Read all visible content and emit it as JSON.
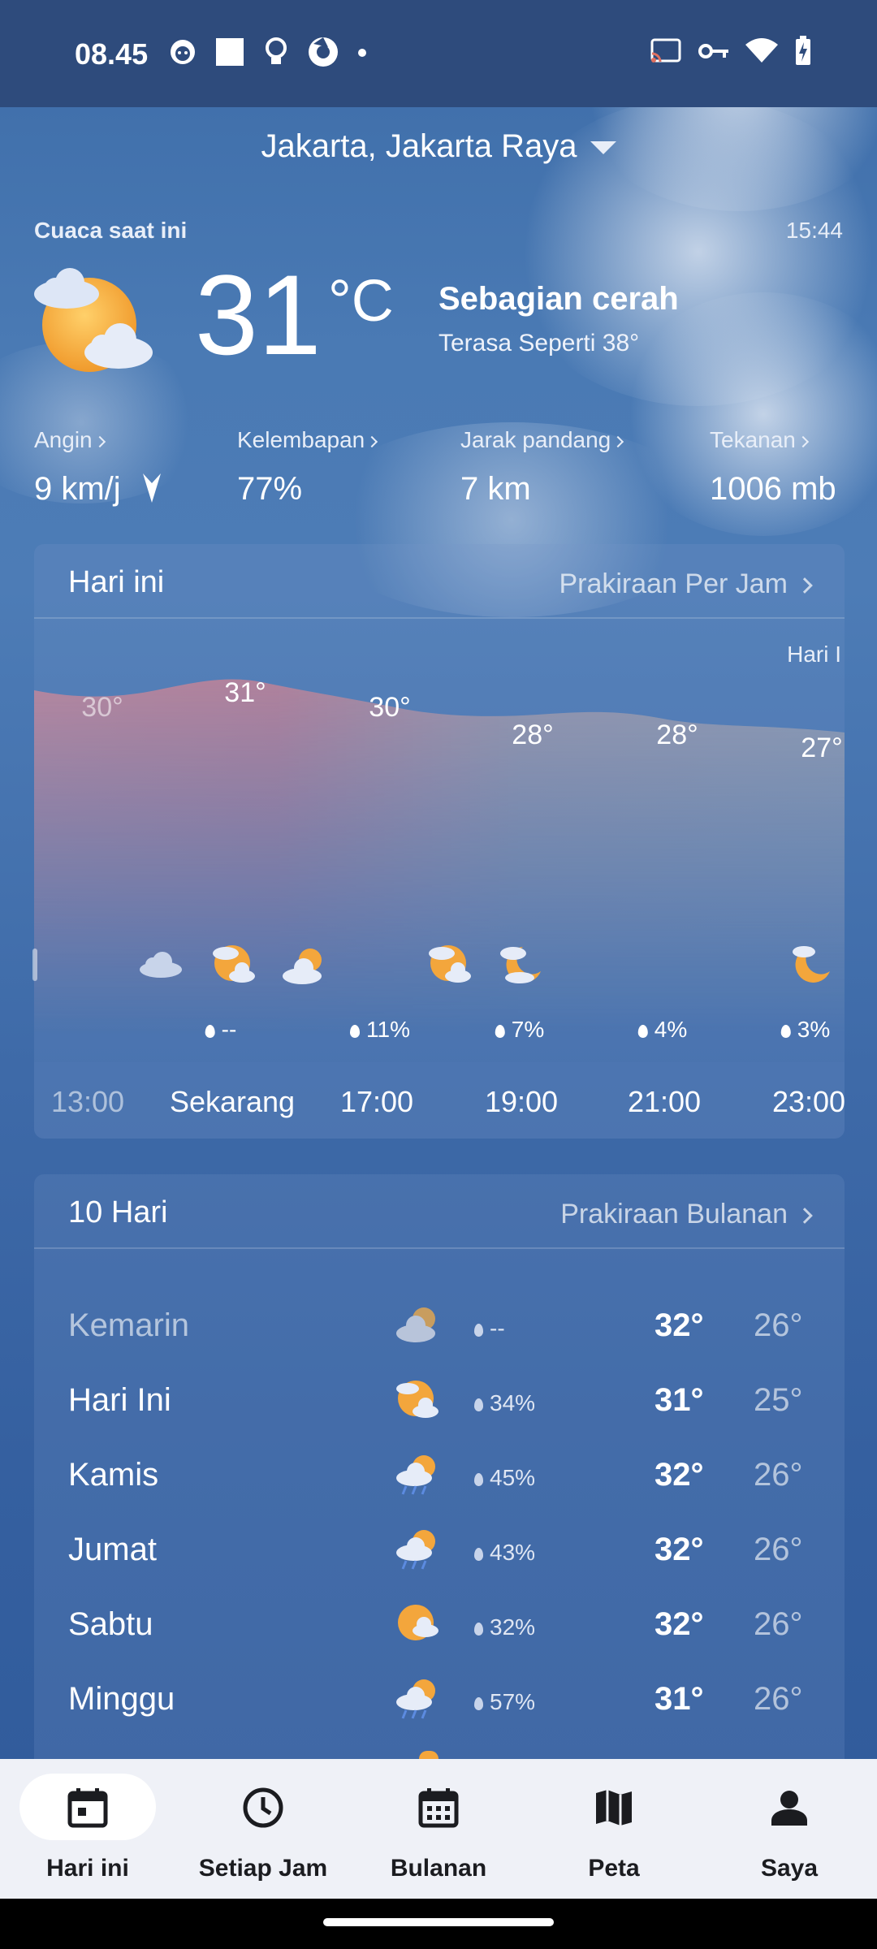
{
  "status_bar": {
    "time": "08.45"
  },
  "location": "Jakarta, Jakarta Raya",
  "current": {
    "label": "Cuaca saat ini",
    "updated": "15:44",
    "temperature": "31",
    "unit": "°C",
    "condition": "Sebagian cerah",
    "feels_like": "Terasa Seperti 38°",
    "icon": "partly-cloudy-icon"
  },
  "metrics": [
    {
      "label": "Angin",
      "value": "9 km/j"
    },
    {
      "label": "Kelembapan",
      "value": "77%"
    },
    {
      "label": "Jarak pandang",
      "value": "7 km"
    },
    {
      "label": "Tekanan",
      "value": "1006 mb"
    }
  ],
  "hourly": {
    "title": "Hari ini",
    "link": "Prakiraan Per Jam",
    "day_marker": "Hari I",
    "temps": [
      "30°",
      "31°",
      "30°",
      "28°",
      "28°",
      "27°"
    ],
    "precip": [
      "--",
      "11%",
      "7%",
      "4%",
      "3%"
    ],
    "times": [
      "13:00",
      "Sekarang",
      "17:00",
      "19:00",
      "21:00",
      "23:00"
    ]
  },
  "daily": {
    "title": "10 Hari",
    "link": "Prakiraan Bulanan",
    "rows": [
      {
        "day": "Kemarin",
        "icon": "cloudy-sun-icon",
        "precip": "--",
        "hi": "32°",
        "lo": "26°"
      },
      {
        "day": "Hari Ini",
        "icon": "partly-cloudy-icon",
        "precip": "34%",
        "hi": "31°",
        "lo": "25°"
      },
      {
        "day": "Kamis",
        "icon": "rain-sun-icon",
        "precip": "45%",
        "hi": "32°",
        "lo": "26°"
      },
      {
        "day": "Jumat",
        "icon": "rain-sun-icon",
        "precip": "43%",
        "hi": "32°",
        "lo": "26°"
      },
      {
        "day": "Sabtu",
        "icon": "sun-cloud-icon",
        "precip": "32%",
        "hi": "32°",
        "lo": "26°"
      },
      {
        "day": "Minggu",
        "icon": "rain-sun-icon",
        "precip": "57%",
        "hi": "31°",
        "lo": "26°"
      }
    ]
  },
  "nav": [
    {
      "label": "Hari ini",
      "icon": "calendar-day-icon",
      "active": true
    },
    {
      "label": "Setiap Jam",
      "icon": "clock-icon",
      "active": false
    },
    {
      "label": "Bulanan",
      "icon": "calendar-month-icon",
      "active": false
    },
    {
      "label": "Peta",
      "icon": "map-icon",
      "active": false
    },
    {
      "label": "Saya",
      "icon": "person-icon",
      "active": false
    }
  ]
}
